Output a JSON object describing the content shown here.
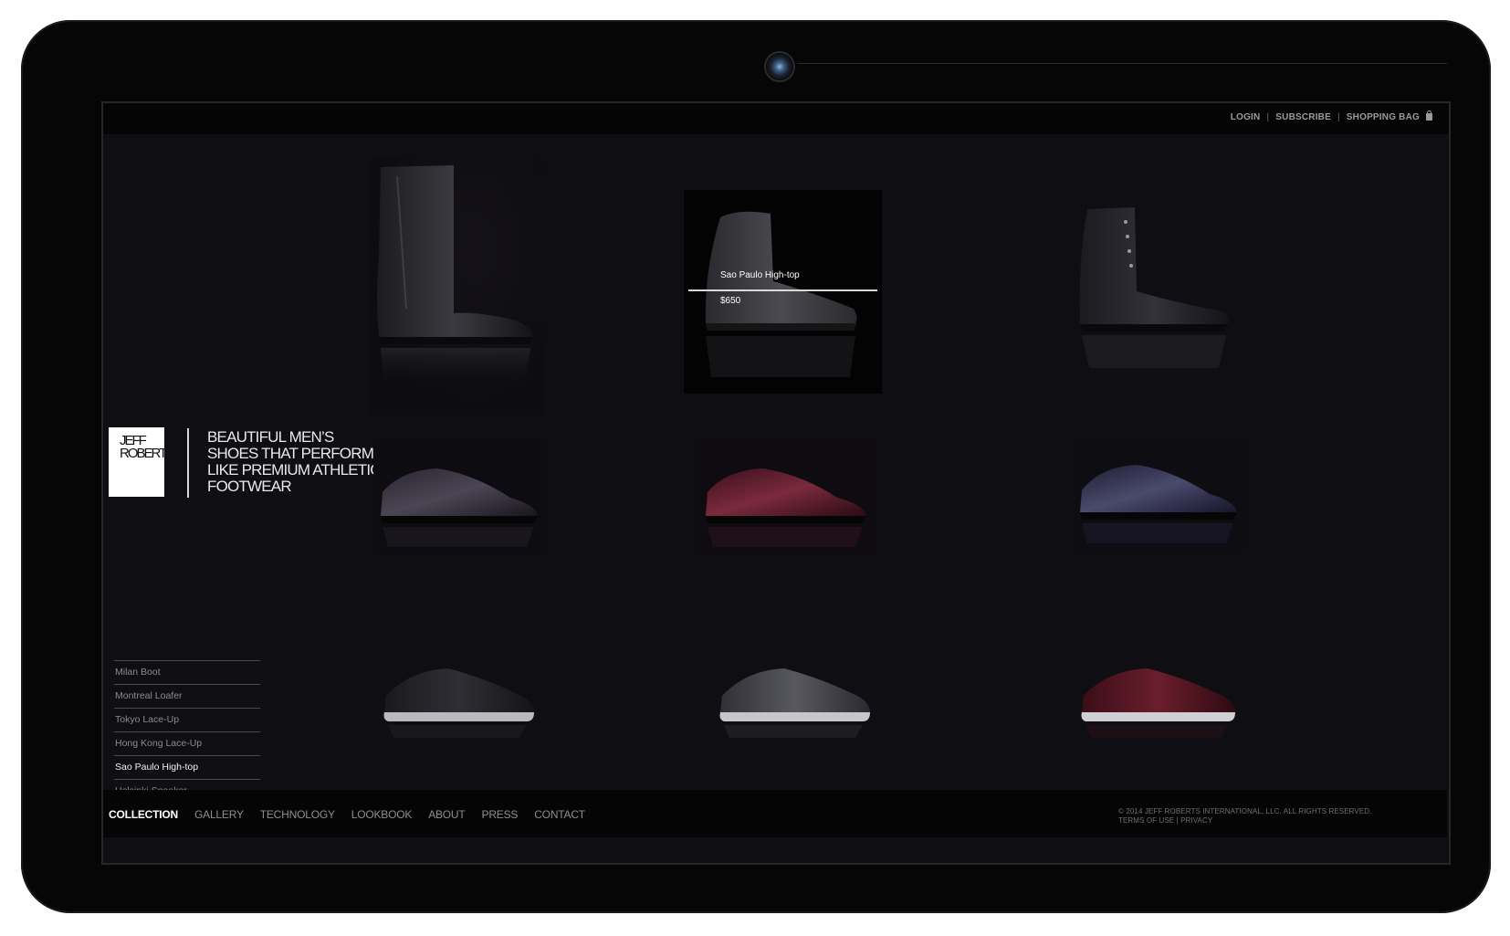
{
  "utility_nav": {
    "login": "LOGIN",
    "subscribe": "SUBSCRIBE",
    "shopping_bag": "SHOPPING BAG",
    "separator": "|"
  },
  "brand": {
    "logo_text": "JEFF ROBERTS",
    "tagline": "BEAUTIFUL MEN’S SHOES THAT PERFORM LIKE PREMIUM ATHLETIC FOOTWEAR"
  },
  "product_list": [
    {
      "label": "Milan Boot",
      "active": false
    },
    {
      "label": "Montreal Loafer",
      "active": false
    },
    {
      "label": "Tokyo Lace-Up",
      "active": false
    },
    {
      "label": "Hong Kong Lace-Up",
      "active": false
    },
    {
      "label": "Sao Paulo High-top",
      "active": true
    },
    {
      "label": "Helsinki Sneaker",
      "active": false
    }
  ],
  "hover_card": {
    "name": "Sao Paulo High-top",
    "price": "$650"
  },
  "main_nav": [
    {
      "label": "COLLECTION",
      "current": true
    },
    {
      "label": "GALLERY",
      "current": false
    },
    {
      "label": "TECHNOLOGY",
      "current": false
    },
    {
      "label": "LOOKBOOK",
      "current": false
    },
    {
      "label": "ABOUT",
      "current": false
    },
    {
      "label": "PRESS",
      "current": false
    },
    {
      "label": "CONTACT",
      "current": false
    }
  ],
  "legal": {
    "copyright": "© 2014 JEFF ROBERTS INTERNATIONAL, LLC. ALL RIGHTS RESERVED.",
    "terms": "TERMS OF USE",
    "separator": "|",
    "privacy": "PRIVACY"
  },
  "colors": {
    "device_bezel": "#060607",
    "screen_bg": "#0f0e12",
    "accent_active": "#ffffff",
    "muted_text": "#8d8d94",
    "burgundy_leather": "#5e1a2a",
    "navy_leather": "#2c2c4a"
  },
  "icons": {
    "bag": "shopping-bag-icon",
    "camera": "webcam-icon"
  }
}
